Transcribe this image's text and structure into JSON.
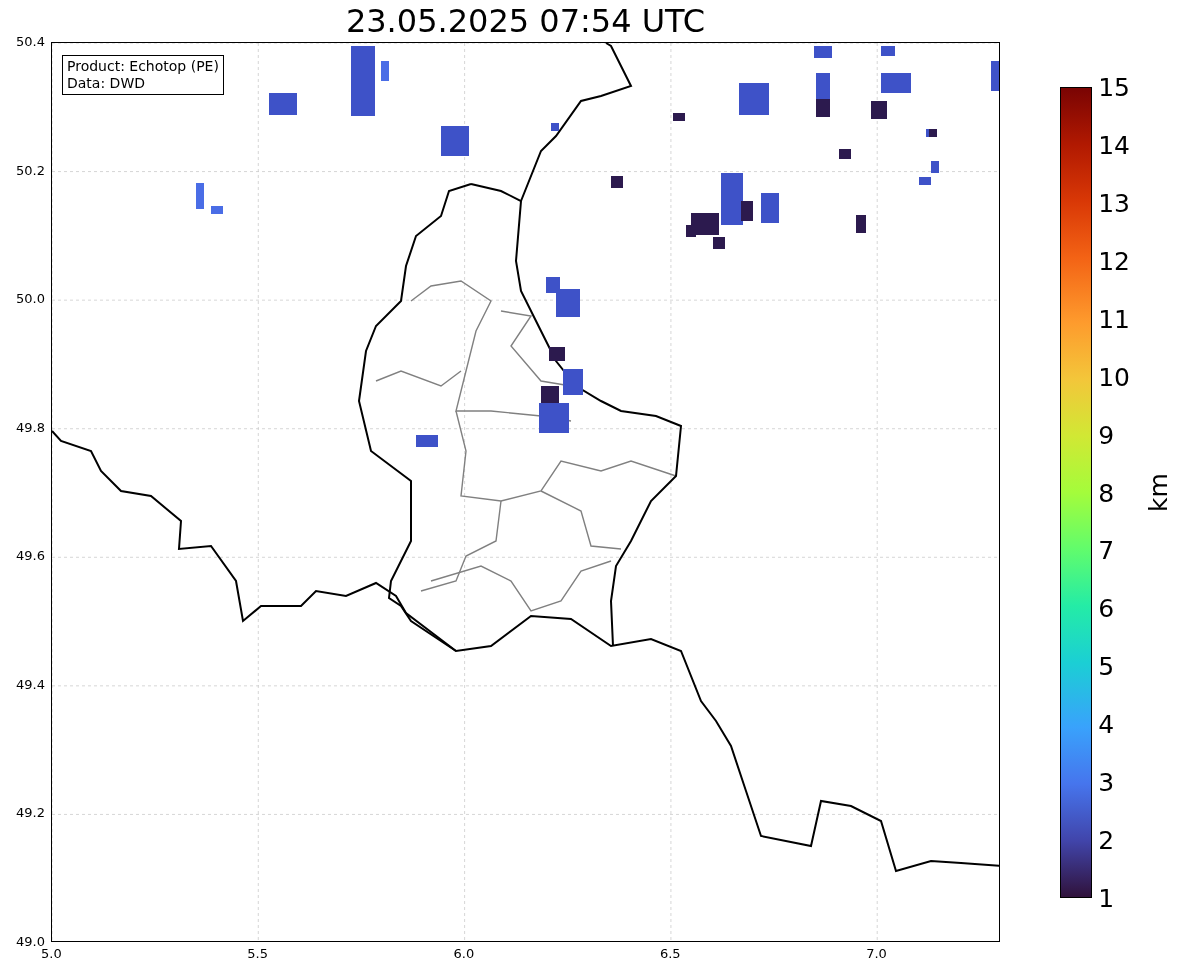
{
  "title": "23.05.2025 07:54 UTC",
  "info_box": {
    "lines": [
      "Product: Echotop (PE)",
      "Data: DWD"
    ]
  },
  "x_axis": {
    "ticks": [
      "5.0",
      "5.5",
      "6.0",
      "6.5",
      "7.0"
    ]
  },
  "y_axis": {
    "ticks": [
      "50.4",
      "50.2",
      "50.0",
      "49.8",
      "49.6",
      "49.4",
      "49.2",
      "49.0"
    ]
  },
  "colorbar": {
    "label": "km",
    "ticks": [
      "15",
      "14",
      "13",
      "12",
      "11",
      "10",
      "9",
      "8",
      "7",
      "6",
      "5",
      "4",
      "3",
      "2",
      "1"
    ]
  }
}
